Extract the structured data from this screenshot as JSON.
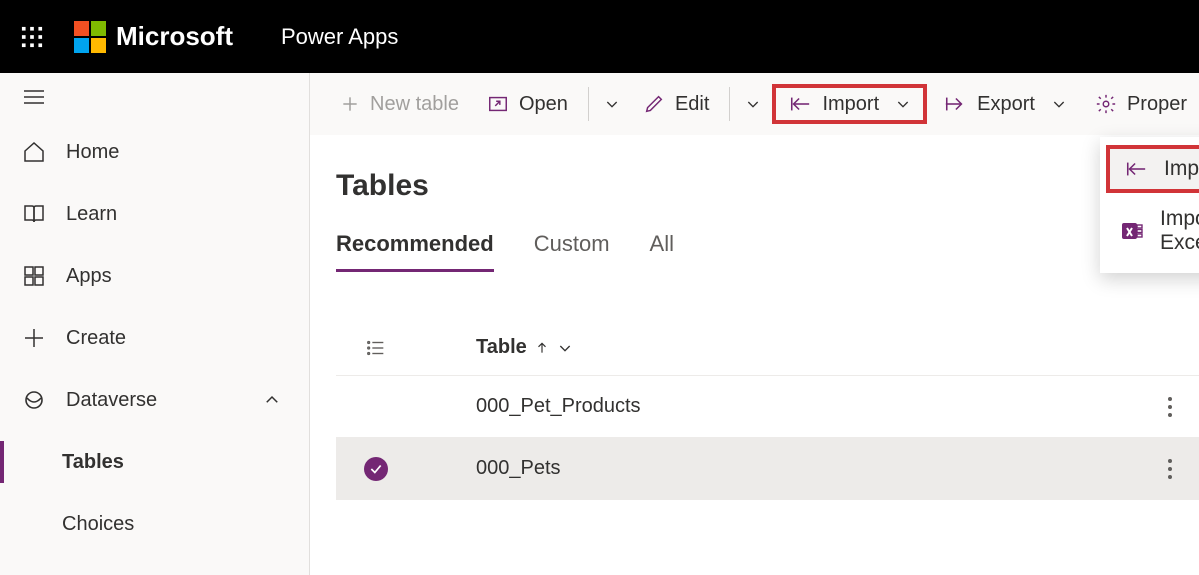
{
  "header": {
    "brand": "Microsoft",
    "app": "Power Apps"
  },
  "sidebar": {
    "items": [
      {
        "label": "Home"
      },
      {
        "label": "Learn"
      },
      {
        "label": "Apps"
      },
      {
        "label": "Create"
      },
      {
        "label": "Dataverse"
      }
    ],
    "subitems": [
      {
        "label": "Tables",
        "active": true
      },
      {
        "label": "Choices",
        "active": false
      }
    ]
  },
  "toolbar": {
    "new_table": "New table",
    "open": "Open",
    "edit": "Edit",
    "import": "Import",
    "export": "Export",
    "properties": "Proper"
  },
  "page": {
    "title": "Tables"
  },
  "tabs": [
    {
      "label": "Recommended",
      "active": true
    },
    {
      "label": "Custom",
      "active": false
    },
    {
      "label": "All",
      "active": false
    }
  ],
  "table": {
    "header": "Table",
    "rows": [
      {
        "name": "000_Pet_Products",
        "selected": false
      },
      {
        "name": "000_Pets",
        "selected": true
      }
    ]
  },
  "dropdown": {
    "items": [
      {
        "label": "Import data",
        "highlight": true
      },
      {
        "label": "Import data from Excel",
        "highlight": false
      }
    ]
  }
}
